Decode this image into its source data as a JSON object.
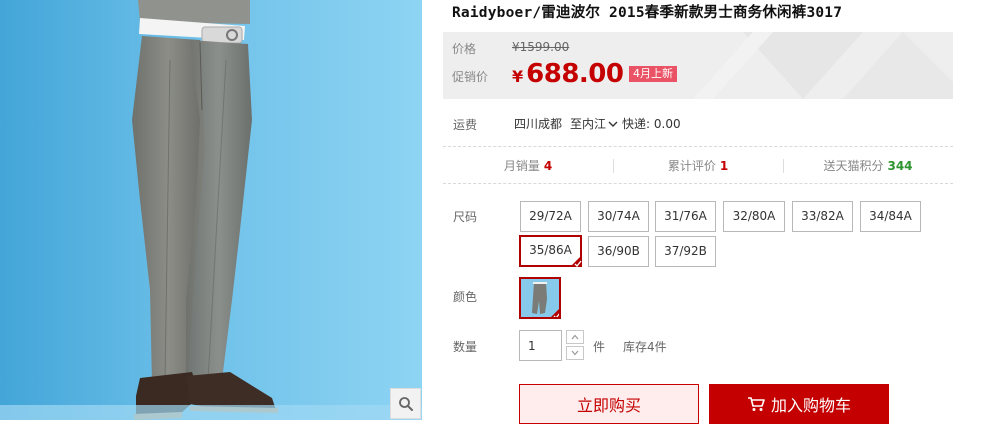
{
  "product": {
    "title": "Raidyboer/雷迪波尔 2015春季新款男士商务休闲裤3017"
  },
  "price": {
    "original_label": "价格",
    "original_value": "¥1599.00",
    "promo_label": "促销价",
    "promo_currency": "¥",
    "promo_value": "688.00",
    "badge": "4月上新"
  },
  "shipping": {
    "label": "运费",
    "from": "四川成都",
    "to": "至内江",
    "method": "快递: 0.00"
  },
  "stats": [
    {
      "label": "月销量",
      "value": "4"
    },
    {
      "label": "累计评价",
      "value": "1"
    },
    {
      "label": "送天猫积分",
      "value": "344"
    }
  ],
  "size": {
    "label": "尺码",
    "options": [
      "29/72A",
      "30/74A",
      "31/76A",
      "32/80A",
      "33/82A",
      "34/84A",
      "35/86A",
      "36/90B",
      "37/92B"
    ],
    "selected": "35/86A"
  },
  "color": {
    "label": "颜色"
  },
  "quantity": {
    "label": "数量",
    "value": "1",
    "unit": "件",
    "stock": "库存4件"
  },
  "actions": {
    "buy_now": "立即购买",
    "add_to_cart": "加入购物车"
  },
  "colors": {
    "accent": "#c40000",
    "badge": "#ea5365",
    "points": "#2d9430",
    "buy_bg": "#ffeded"
  },
  "icons": {
    "zoom": "magnifier-icon",
    "cart": "cart-icon",
    "dropdown": "chevron-down-icon",
    "selected": "check-corner-icon"
  }
}
